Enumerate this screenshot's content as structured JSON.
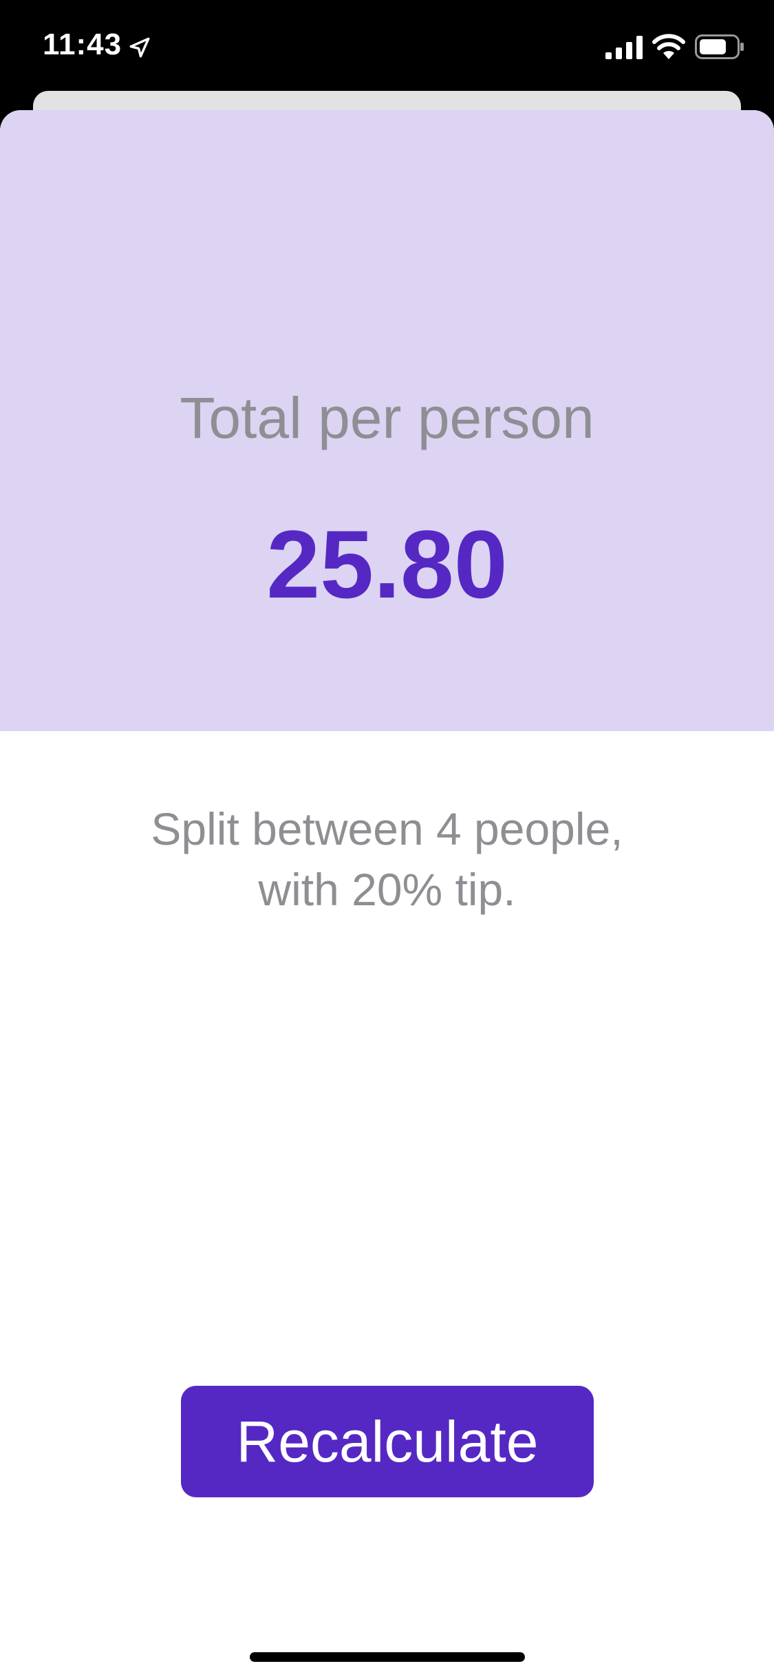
{
  "status_bar": {
    "time": "11:43",
    "icons": [
      "location-arrow-icon",
      "cellular-signal-icon",
      "wifi-icon",
      "battery-icon"
    ]
  },
  "result": {
    "label": "Total per person",
    "value": "25.80"
  },
  "summary": {
    "line1": "Split between 4 people,",
    "line2": "with 20% tip."
  },
  "actions": {
    "recalculate_label": "Recalculate"
  },
  "colors": {
    "accent": "#5528C4",
    "panel_background": "#DCD4F2",
    "secondary_text": "#8E8E93"
  }
}
